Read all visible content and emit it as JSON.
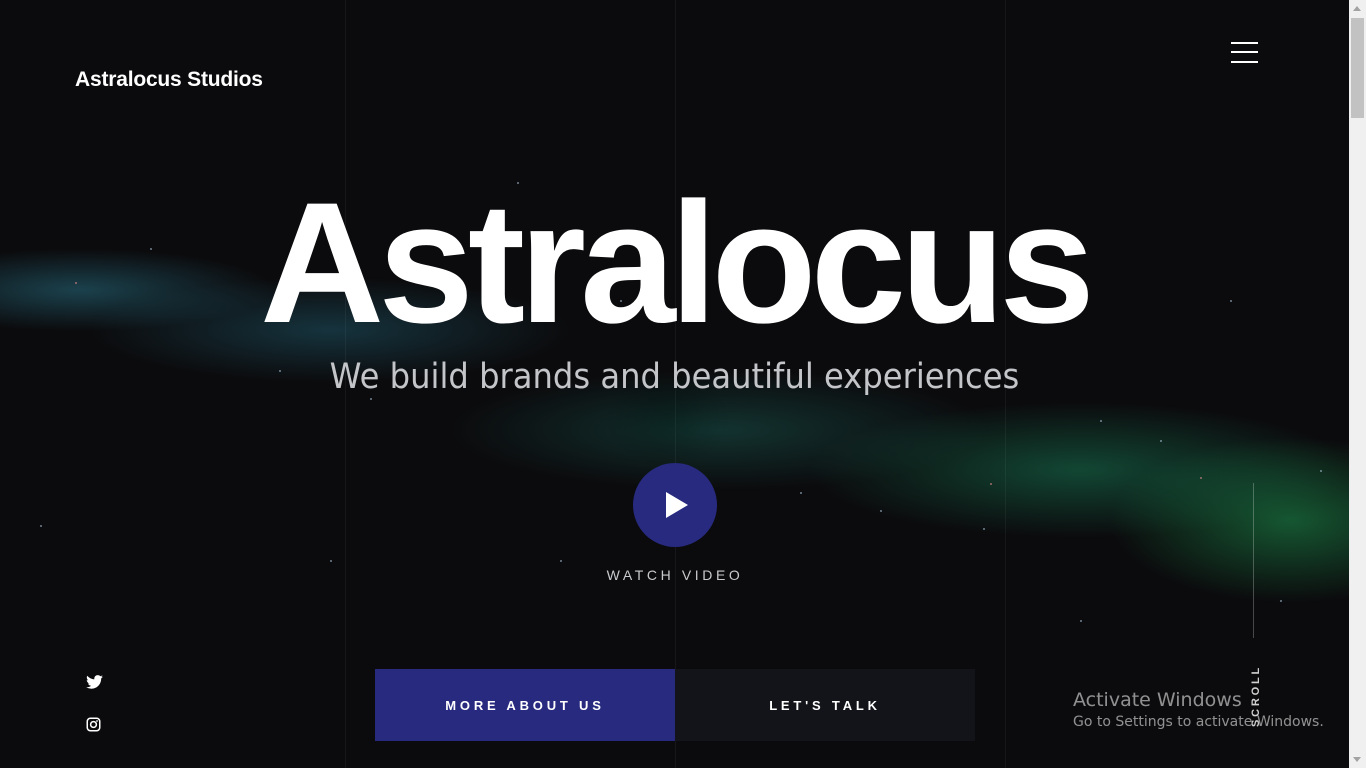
{
  "header": {
    "logo": "Astralocus Studios",
    "menu_icon": "hamburger-menu-icon"
  },
  "hero": {
    "title": "Astralocus",
    "subtitle": "We build brands and beautiful experiences",
    "play_icon": "play-icon",
    "watch_label": "WATCH VIDEO"
  },
  "social": [
    {
      "icon": "twitter-icon"
    },
    {
      "icon": "instagram-icon"
    }
  ],
  "cta": {
    "primary_label": "MORE ABOUT US",
    "secondary_label": "LET'S TALK"
  },
  "scroll": {
    "label": "SCROLL"
  },
  "watermark": {
    "title": "Activate Windows",
    "subtitle": "Go to Settings to activate Windows."
  },
  "colors": {
    "background": "#0b0b0d",
    "accent": "#272a7f",
    "secondary_button": "#12141a",
    "text": "#ffffff"
  }
}
